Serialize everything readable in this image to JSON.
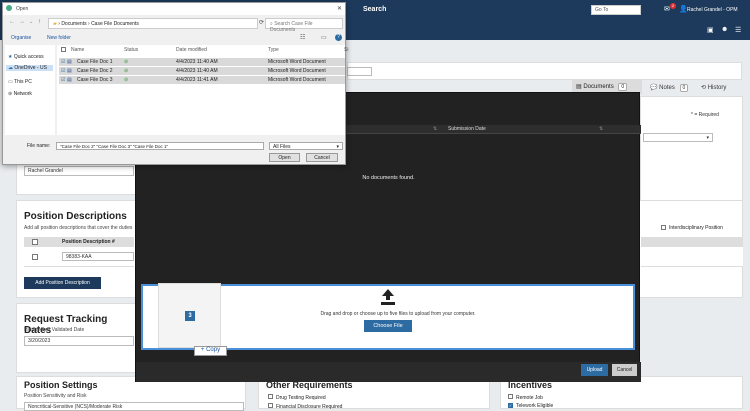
{
  "topbar": {
    "search_label": "Search",
    "goto_placeholder": "Go To",
    "mail_count": "2",
    "user": "Rachel Grandel - OPM"
  },
  "page": {
    "tabs": [
      {
        "label": "Documents",
        "count": "0"
      },
      {
        "label": "Notes",
        "count": "0"
      },
      {
        "label": "History"
      }
    ],
    "required_note": "* = Required",
    "name_value": "Rachel Grandel",
    "position_descriptions": {
      "title": "Position Descriptions",
      "subtitle": "Add all position descriptions that cover the duties",
      "col_header": "Position Description #",
      "row_value": "98383-KAA",
      "add_button": "Add Position Description",
      "interdisciplinary": "Interdisciplinary Position"
    },
    "request_tracking": {
      "title": "Request Tracking Dates",
      "label": "Hiring Need Validated Date",
      "value": "3/20/2023"
    },
    "position_settings": {
      "title": "Position Settings",
      "label": "Position Sensitivity and Risk",
      "value": "Noncritical-Sensitive (NCS)/Moderate Risk"
    },
    "other_requirements": {
      "title": "Other Requirements",
      "items": [
        "Drug Testing Required",
        "Financial Disclosure Required"
      ]
    },
    "incentives": {
      "title": "Incentives",
      "items": [
        "Remote Job",
        "Telework Eligible"
      ]
    }
  },
  "modal": {
    "col_submission": "Submission Date",
    "empty_text": "No documents found.",
    "drop_text": "Drag and drop or choose up to five files to upload from your computer.",
    "choose_button": "Choose File",
    "drag_count": "3",
    "copy_label": "+ Copy",
    "upload_button": "Upload",
    "cancel_button": "Cancel"
  },
  "dialog": {
    "title": "Open",
    "path": [
      "Documents",
      "Case File Documents"
    ],
    "search_placeholder": "Search Case File Documents",
    "organise": "Organise",
    "new_folder": "New folder",
    "nav": [
      "Quick access",
      "OneDrive - US",
      "This PC",
      "Network"
    ],
    "columns": [
      "Name",
      "Status",
      "Date modified",
      "Type",
      "Si"
    ],
    "files": [
      {
        "name": "Case File Doc 1",
        "date": "4/4/2023 11:40 AM",
        "type": "Microsoft Word Document"
      },
      {
        "name": "Case File Doc 2",
        "date": "4/4/2023 11:40 AM",
        "type": "Microsoft Word Document"
      },
      {
        "name": "Case File Doc 3",
        "date": "4/4/2023 11:41 AM",
        "type": "Microsoft Word Document"
      }
    ],
    "file_name_label": "File name:",
    "file_name_value": "\"Case File Doc 2\" \"Case File Doc 3\" \"Case File Doc 1\"",
    "filter": "All Files",
    "open_button": "Open",
    "cancel_button": "Cancel"
  },
  "colors": {
    "navy": "#1d3a5c",
    "accent": "#2d6ca2",
    "modal_bg": "#222222"
  }
}
